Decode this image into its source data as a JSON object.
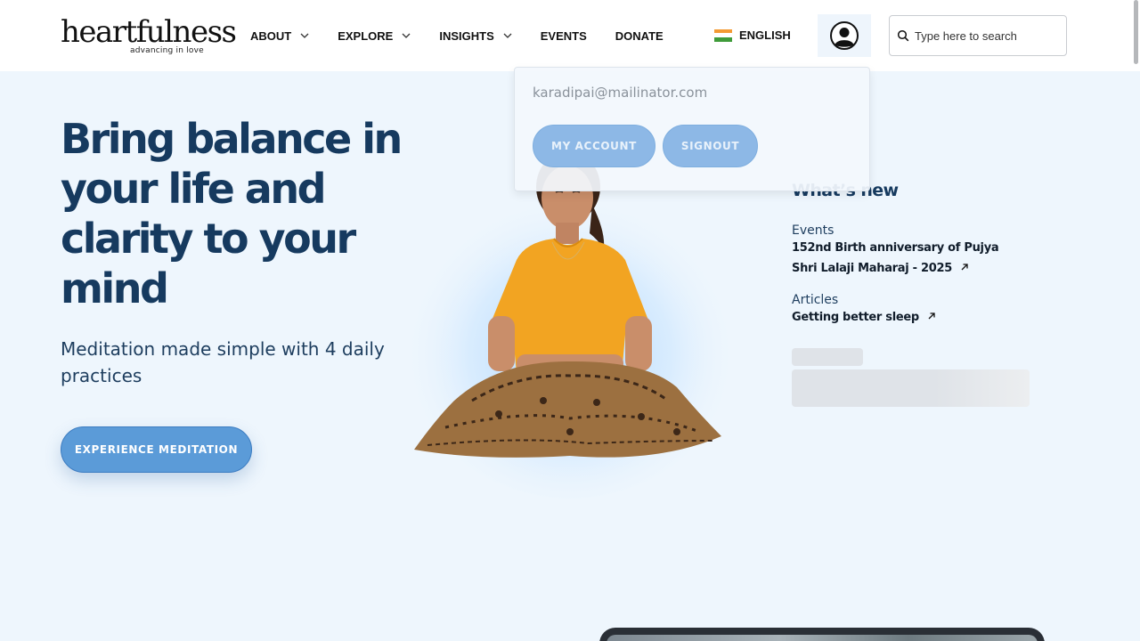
{
  "brand": {
    "name": "heartfulness",
    "tagline": "advancing in love"
  },
  "nav": {
    "items": [
      {
        "label": "ABOUT",
        "has_dropdown": true
      },
      {
        "label": "EXPLORE",
        "has_dropdown": true
      },
      {
        "label": "INSIGHTS",
        "has_dropdown": true
      },
      {
        "label": "EVENTS",
        "has_dropdown": false
      },
      {
        "label": "DONATE",
        "has_dropdown": false
      }
    ],
    "language": "ENGLISH",
    "search_placeholder": "Type here to search"
  },
  "hero": {
    "title": "Bring balance in your life and clarity to your mind",
    "subtitle": "Meditation made simple with 4 daily practices",
    "cta": "EXPERIENCE MEDITATION"
  },
  "whats_new": {
    "title": "What’s new",
    "items": [
      {
        "category": "Events",
        "link": "152nd Birth anniversary of Pujya Shri Lalaji Maharaj - 2025"
      },
      {
        "category": "Articles",
        "link": "Getting better sleep"
      }
    ]
  },
  "account_menu": {
    "email": "karadipai@mailinator.com",
    "my_account": "MY ACCOUNT",
    "signout": "SIGNOUT"
  },
  "colors": {
    "accent": "#5b9bd8",
    "heading": "#163a5f",
    "background": "#eef6fd"
  }
}
